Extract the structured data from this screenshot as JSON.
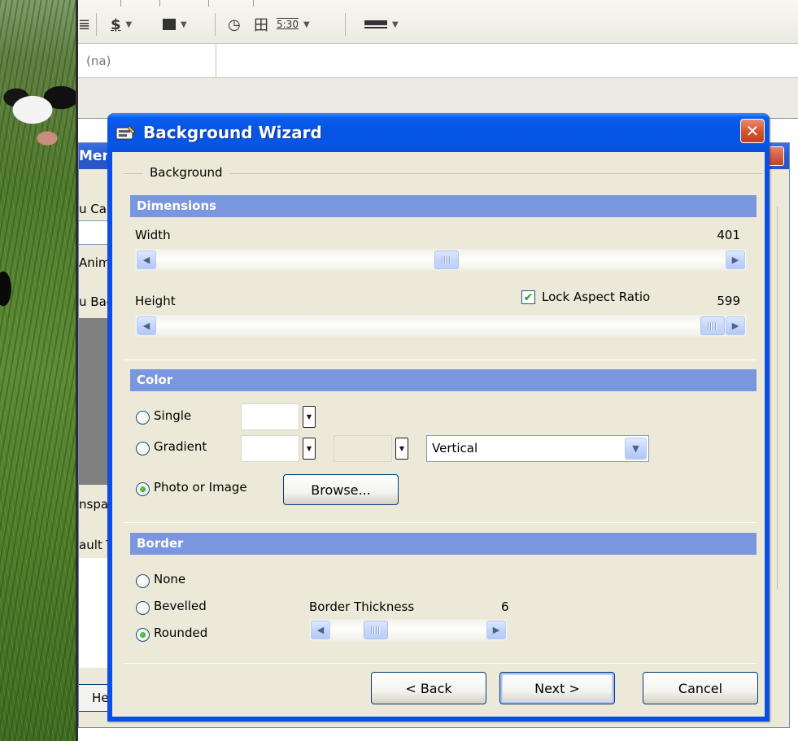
{
  "background_app": {
    "toolbar": {
      "items": [
        "dollar-icon",
        "fill-icon",
        "clock-icon",
        "table-icon",
        "time-format-icon",
        "line-style-icon"
      ],
      "time_format_label": "5:30"
    },
    "formula_cell_value": "(na)",
    "menu_dialog": {
      "title_fragment": "Menu",
      "labels": [
        "u Ca",
        "Anim",
        "u Bac",
        "nspa",
        "ault T"
      ],
      "button_fragment": "He"
    }
  },
  "wizard": {
    "title": "Background Wizard",
    "group_label": "Background",
    "dimensions": {
      "header": "Dimensions",
      "width_label": "Width",
      "width_value": "401",
      "width_fraction": 0.51,
      "height_label": "Height",
      "height_value": "599",
      "height_fraction": 1.0,
      "lock_aspect_label": "Lock Aspect Ratio",
      "lock_aspect_checked": true
    },
    "color": {
      "header": "Color",
      "options": [
        {
          "label": "Single",
          "selected": false
        },
        {
          "label": "Gradient",
          "selected": false
        },
        {
          "label": "Photo or Image",
          "selected": true
        }
      ],
      "gradient_direction": "Vertical",
      "browse_label": "Browse..."
    },
    "border": {
      "header": "Border",
      "options": [
        {
          "label": "None",
          "selected": false
        },
        {
          "label": "Bevelled",
          "selected": false
        },
        {
          "label": "Rounded",
          "selected": true
        }
      ],
      "thickness_label": "Border Thickness",
      "thickness_value": "6",
      "thickness_fraction": 0.25
    },
    "buttons": {
      "back": "< Back",
      "next": "Next >",
      "cancel": "Cancel"
    }
  },
  "colors": {
    "titlebar": "#0554e3",
    "section_header": "#7a96df",
    "dialog_bg": "#ece9d8",
    "close_button": "#d4522e"
  }
}
